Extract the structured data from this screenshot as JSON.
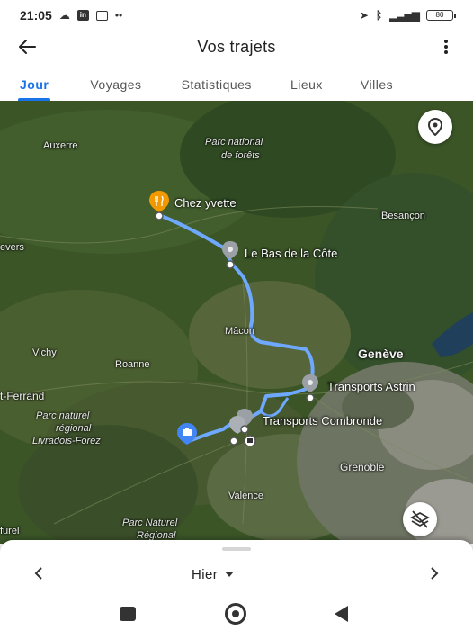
{
  "status_bar": {
    "time": "21:05",
    "left_icons": [
      "cloud-icon",
      "linkedin-icon",
      "message-icon",
      "more-dots-icon"
    ],
    "right_icons": [
      "location-arrow-icon",
      "bluetooth-icon",
      "signal-icon"
    ],
    "battery": "80"
  },
  "app_bar": {
    "title": "Vos trajets",
    "back_icon": "arrow-left-icon",
    "menu_icon": "more-vert-icon"
  },
  "tabs": [
    {
      "label": "Jour",
      "active": true
    },
    {
      "label": "Voyages",
      "active": false
    },
    {
      "label": "Statistiques",
      "active": false
    },
    {
      "label": "Lieux",
      "active": false
    },
    {
      "label": "Villes",
      "active": false
    }
  ],
  "map": {
    "labels": {
      "auxerre": "Auxerre",
      "parc_foret_1": "Parc national",
      "parc_foret_2": "de forêts",
      "besancon": "Besançon",
      "nevers": "evers",
      "macon": "Mâcon",
      "geneve": "Genève",
      "vichy": "Vichy",
      "roanne": "Roanne",
      "clermont": "t-Ferrand",
      "livradois_1": "Parc naturel",
      "livradois_2": "régional",
      "livradois_3": "Livradois-Forez",
      "grenoble": "Grenoble",
      "valence": "Valence",
      "parc_bottom_1": "Parc Naturel",
      "parc_bottom_2": "Régional",
      "bottom_left": "furel"
    },
    "places": {
      "chez_yvette": "Chez yvette",
      "bas_de_la_cote": "Le Bas de la Côte",
      "transports_astrin": "Transports Astrin",
      "transports_combronde": "Transports Combronde"
    },
    "route_color": "#6fa8ff",
    "restaurant_pin_color": "#f29900",
    "work_pin_color": "#4285f4",
    "location_button_icon": "location-pin-icon",
    "layers_button_icon": "layers-off-icon"
  },
  "bottom_sheet": {
    "date_label": "Hier",
    "prev_icon": "chevron-left-icon",
    "next_icon": "chevron-right-icon"
  },
  "android_nav": {
    "recent_icon": "square-icon",
    "home_icon": "circle-icon",
    "back_icon": "triangle-back-icon"
  }
}
